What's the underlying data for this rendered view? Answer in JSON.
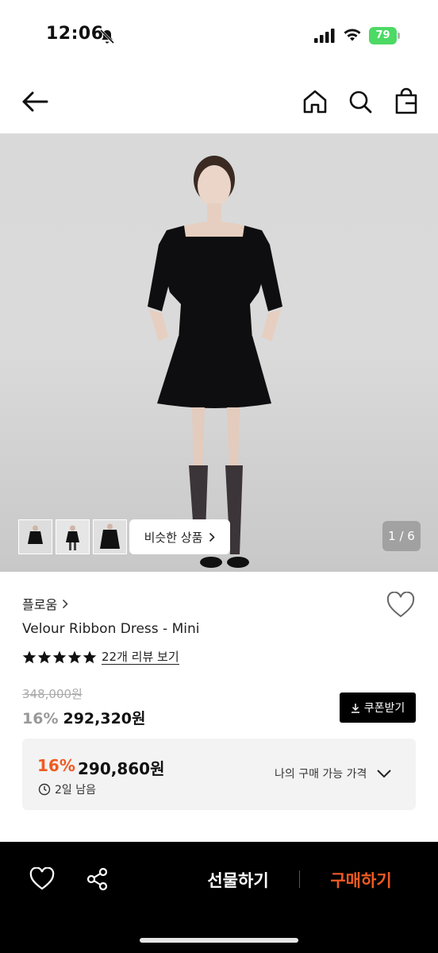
{
  "status_bar": {
    "time": "12:06",
    "battery": "79"
  },
  "nav": {
    "back": "back",
    "home": "home",
    "search": "search",
    "bag": "shopping-bag"
  },
  "gallery": {
    "similar_label": "비슷한 상품",
    "pager": "1 / 6",
    "thumb_count": 3
  },
  "product": {
    "brand": "플로움",
    "name": "Velour Ribbon Dress - Mini",
    "rating_stars": 5,
    "review_link": "22개 리뷰 보기",
    "original_price": "348,000원",
    "discount": "16%",
    "price": "292,320원",
    "coupon_label": "쿠폰받기"
  },
  "my_price": {
    "discount": "16%",
    "price": "290,860원",
    "timer": "2일 남음",
    "toggle_label": "나의 구매 가능 가격"
  },
  "bottom_bar": {
    "gift_label": "선물하기",
    "buy_label": "구매하기"
  },
  "colors": {
    "accent": "#f05a23",
    "black": "#000000",
    "price_box": "#f3f3f3"
  }
}
